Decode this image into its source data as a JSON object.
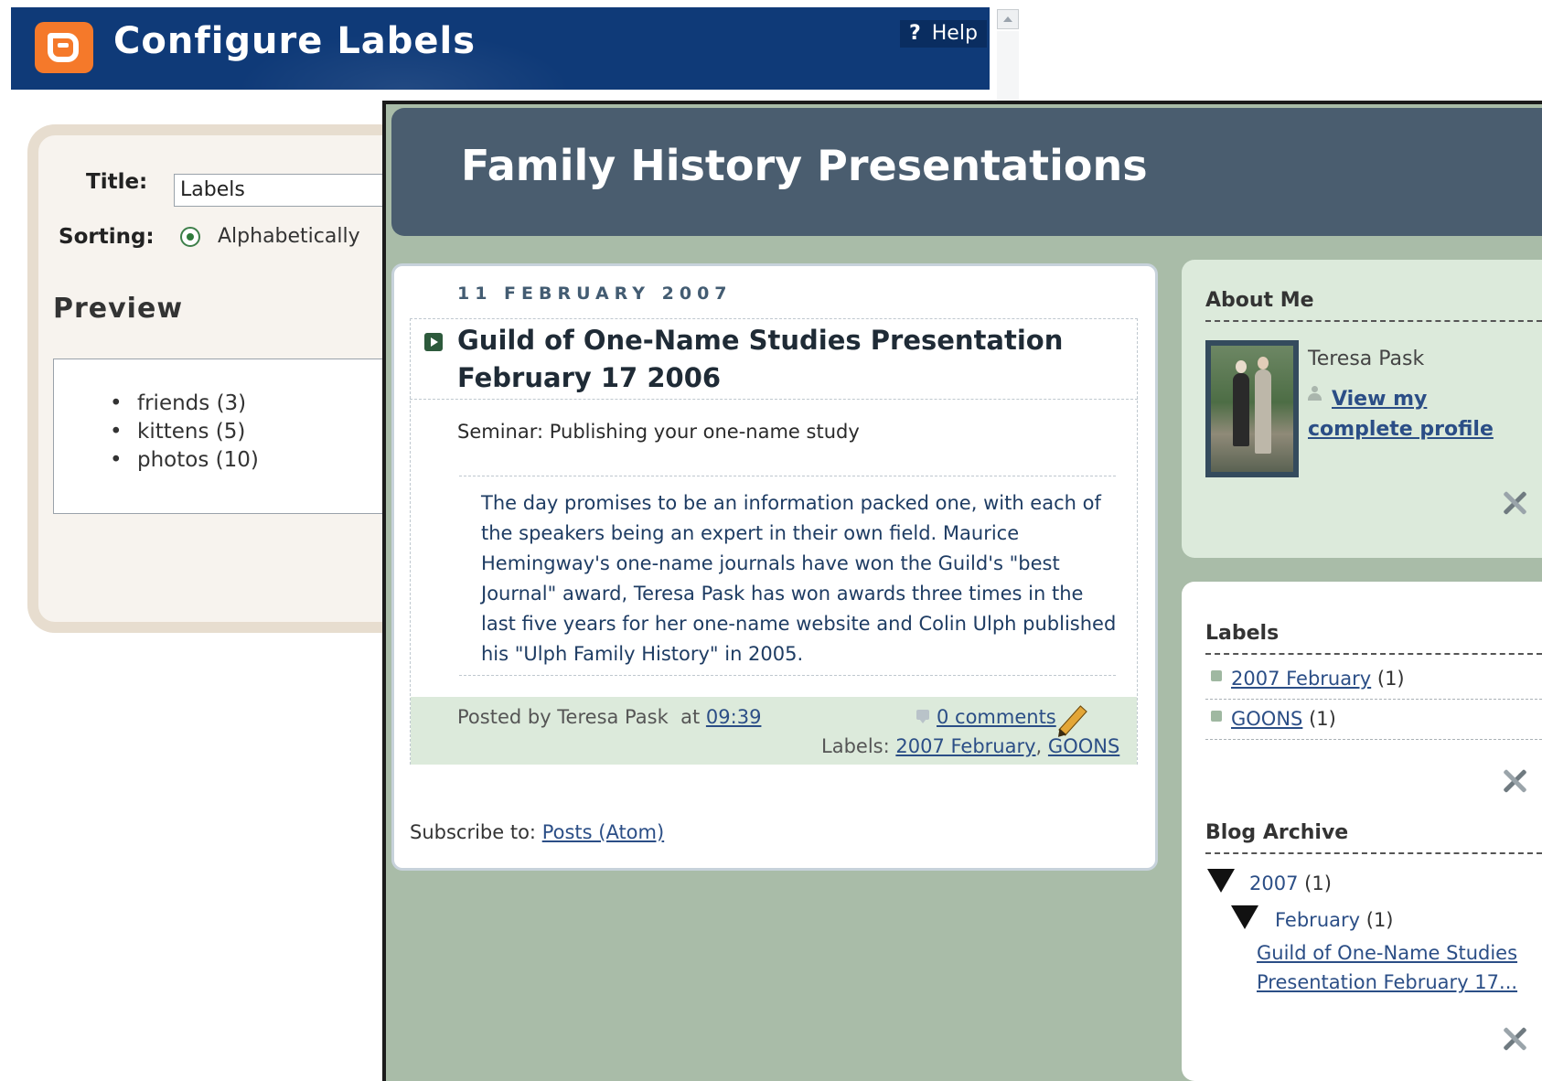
{
  "config_window": {
    "title": "Configure Labels",
    "help_label": "Help",
    "help_symbol": "?",
    "title_field_label": "Title:",
    "title_field_value": "Labels",
    "sorting_label": "Sorting:",
    "sorting_selected": "Alphabetically",
    "preview_heading": "Preview",
    "preview_items": [
      "friends (3)",
      "kittens (5)",
      "photos (10)"
    ]
  },
  "blog": {
    "title": "Family History Presentations",
    "post": {
      "date": "11 FEBRUARY 2007",
      "title": "Guild of One-Name Studies Presentation February 17 2006",
      "subtitle": "Seminar: Publishing your one-name study",
      "body": "The day promises to be an information packed one, with each of the speakers being an expert in their own field. Maurice Hemingway's one-name journals have won the Guild's \"best Journal\" award, Teresa Pask has won awards three times in the last five years for her one-name website and Colin Ulph published his \"Ulph Family History\" in 2005.",
      "posted_by_prefix": "Posted by Teresa Pask",
      "at": "at",
      "time": "09:39",
      "comments": "0 comments",
      "labels_prefix": "Labels:",
      "labels": [
        "2007 February",
        "GOONS"
      ],
      "label_separator": ","
    },
    "subscribe_prefix": "Subscribe to:",
    "subscribe_link": "Posts (Atom)"
  },
  "sidebar": {
    "about": {
      "heading": "About Me",
      "name": "Teresa Pask",
      "profile_link": "View my complete profile"
    },
    "labels": {
      "heading": "Labels",
      "items": [
        {
          "name": "2007 February",
          "count": "(1)"
        },
        {
          "name": "GOONS",
          "count": "(1)"
        }
      ]
    },
    "archive": {
      "heading": "Blog Archive",
      "year": "2007",
      "year_count": "(1)",
      "month": "February",
      "month_count": "(1)",
      "post_link": "Guild of One-Name Studies Presentation February 17..."
    }
  },
  "colors": {
    "config_header": "#0f3a78",
    "blogger_orange": "#f5792a",
    "blog_header": "#4a5d6f",
    "blog_background": "#a9bca8",
    "link": "#2b4e86"
  }
}
